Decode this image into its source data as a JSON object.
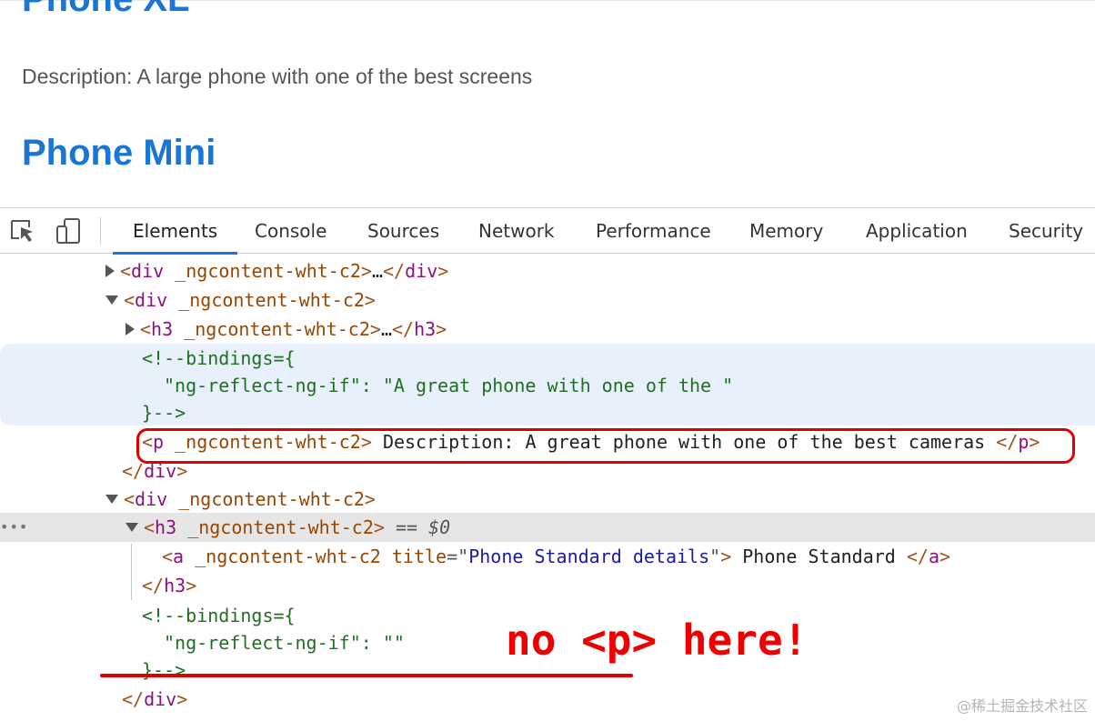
{
  "preview": {
    "heading_clipped": "Phone XL",
    "description": "Description: A large phone with one of the best screens",
    "heading_next": "Phone Mini"
  },
  "toolbar": {
    "tabs": [
      {
        "label": "Elements",
        "active": true
      },
      {
        "label": "Console"
      },
      {
        "label": "Sources"
      },
      {
        "label": "Network"
      },
      {
        "label": "Performance"
      },
      {
        "label": "Memory"
      },
      {
        "label": "Application"
      },
      {
        "label": "Security"
      }
    ]
  },
  "tree": {
    "tag_div": "div",
    "tag_h3": "h3",
    "tag_p": "p",
    "tag_a": "a",
    "ng_attr": "_ngcontent-wht-c2",
    "ellipsis": "…",
    "comment_open": "<!--bindings={",
    "binding_key": "\"ng-reflect-ng-if\"",
    "binding_value_1": "\"A great phone with one of the \"",
    "binding_value_2": "\"\"",
    "comment_close": "}-->",
    "p_text": "Description: A great phone with one of the best cameras",
    "a_title_attr": "title",
    "a_title_value": "Phone Standard details",
    "a_text": "Phone Standard",
    "selected_marker": "== $0",
    "dots": "•••"
  },
  "annotation": {
    "text": "no <p> here!",
    "color": "#e00000"
  },
  "watermark": "@稀土掘金技术社区",
  "colors": {
    "accent": "#1a73e8",
    "heading": "#1976d2"
  }
}
